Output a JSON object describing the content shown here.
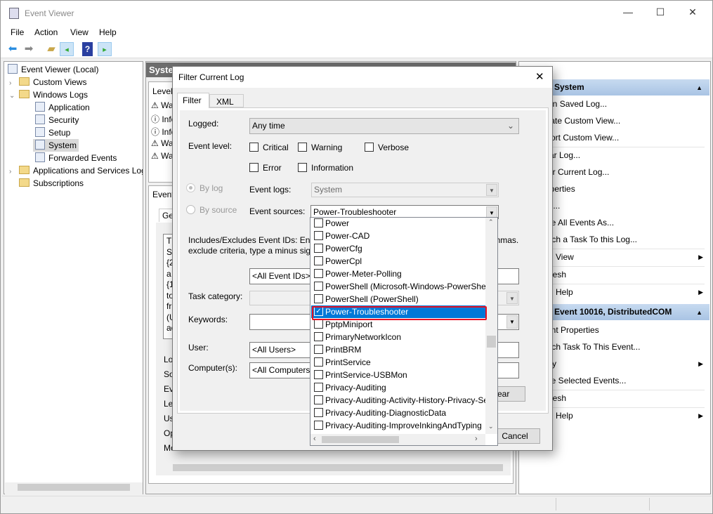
{
  "window": {
    "title": "Event Viewer",
    "controls": {
      "minimize": "—",
      "maximize": "☐",
      "close": "✕"
    }
  },
  "menu": [
    "File",
    "Action",
    "View",
    "Help"
  ],
  "toolbar": [
    "back-icon",
    "forward-icon",
    "open-folder-icon",
    "show-hide-tree-icon",
    "help-icon",
    "show-hide-action-pane-icon"
  ],
  "tree": {
    "root": "Event Viewer (Local)",
    "items": [
      {
        "label": "Custom Views",
        "level": 1,
        "expander": "›"
      },
      {
        "label": "Windows Logs",
        "level": 1,
        "expander": "⌄"
      },
      {
        "label": "Application",
        "level": 2
      },
      {
        "label": "Security",
        "level": 2
      },
      {
        "label": "Setup",
        "level": 2
      },
      {
        "label": "System",
        "level": 2,
        "selected": true
      },
      {
        "label": "Forwarded Events",
        "level": 2
      },
      {
        "label": "Applications and Services Logs",
        "level": 1,
        "expander": "›"
      },
      {
        "label": "Subscriptions",
        "level": 1
      }
    ]
  },
  "middle": {
    "header": "System",
    "list_header": "Level",
    "rows": [
      "Warning",
      "Information",
      "Information",
      "Warning",
      "Warning"
    ],
    "detail_header": "Event",
    "detail_tab": "General",
    "detail_text": [
      "Th",
      "Se",
      "{2",
      "a",
      "{1",
      "to",
      "fr",
      "(U",
      "ac"
    ],
    "detail_fields": [
      "Log",
      "Sou",
      "Eve",
      "Lev",
      "Use",
      "Op",
      "Mo"
    ]
  },
  "actions": {
    "section1": {
      "title": "System",
      "items": [
        {
          "label": "Open Saved Log..."
        },
        {
          "label": "Create Custom View..."
        },
        {
          "label": "Import Custom View..."
        },
        {
          "label": "Clear Log..."
        },
        {
          "label": "Filter Current Log..."
        },
        {
          "label": "Properties"
        },
        {
          "label": "Find..."
        },
        {
          "label": "Save All Events As..."
        },
        {
          "label": "Attach a Task To this Log..."
        },
        {
          "label": "View",
          "submenu": true
        },
        {
          "label": "Refresh"
        },
        {
          "label": "Help",
          "submenu": true
        }
      ]
    },
    "section2": {
      "title": "Event 10016, DistributedCOM",
      "items": [
        {
          "label": "Event Properties"
        },
        {
          "label": "Attach Task To This Event..."
        },
        {
          "label": "Copy",
          "submenu": true
        },
        {
          "label": "Save Selected Events..."
        },
        {
          "label": "Refresh"
        },
        {
          "label": "Help",
          "submenu": true
        }
      ]
    }
  },
  "dialog": {
    "title": "Filter Current Log",
    "tabs": [
      "Filter",
      "XML"
    ],
    "logged_label": "Logged:",
    "logged_value": "Any time",
    "event_level_label": "Event level:",
    "levels": [
      {
        "label": "Critical",
        "checked": false
      },
      {
        "label": "Warning",
        "checked": false
      },
      {
        "label": "Verbose",
        "checked": false
      },
      {
        "label": "Error",
        "checked": false
      },
      {
        "label": "Information",
        "checked": false
      }
    ],
    "by_log": "By log",
    "by_source": "By source",
    "event_logs_label": "Event logs:",
    "event_logs_value": "System",
    "event_sources_label": "Event sources:",
    "event_sources_value": "Power-Troubleshooter",
    "ids_text1": "Includes/Excludes Event IDs: Enter ID numbers and/or ID ranges separated by commas. To",
    "ids_text2": "exclude criteria, type a minus sign first. For example 1,3,5-99,-76",
    "ids_value": "<All Event IDs>",
    "task_label": "Task category:",
    "keywords_label": "Keywords:",
    "user_label": "User:",
    "user_value": "<All Users>",
    "computer_label": "Computer(s):",
    "computer_value": "<All Computers>",
    "clear_button": "Clear",
    "cancel_button": "Cancel",
    "close": "✕"
  },
  "sources_dropdown": [
    {
      "label": "Power",
      "checked": false
    },
    {
      "label": "Power-CAD",
      "checked": false
    },
    {
      "label": "PowerCfg",
      "checked": false
    },
    {
      "label": "PowerCpl",
      "checked": false
    },
    {
      "label": "Power-Meter-Polling",
      "checked": false
    },
    {
      "label": "PowerShell (Microsoft-Windows-PowerShell)",
      "checked": false
    },
    {
      "label": "PowerShell (PowerShell)",
      "checked": false
    },
    {
      "label": "Power-Troubleshooter",
      "checked": true,
      "selected": true
    },
    {
      "label": "PptpMiniport",
      "checked": false
    },
    {
      "label": "PrimaryNetworkIcon",
      "checked": false
    },
    {
      "label": "PrintBRM",
      "checked": false
    },
    {
      "label": "PrintService",
      "checked": false
    },
    {
      "label": "PrintService-USBMon",
      "checked": false
    },
    {
      "label": "Privacy-Auditing",
      "checked": false
    },
    {
      "label": "Privacy-Auditing-Activity-History-Privacy-Settings",
      "checked": false
    },
    {
      "label": "Privacy-Auditing-DiagnosticData",
      "checked": false
    },
    {
      "label": "Privacy-Auditing-ImproveInkingAndTyping",
      "checked": false
    }
  ],
  "colors": {
    "selection": "#0078d7",
    "highlight_box": "#e81123",
    "action_header": "#b7cfea"
  }
}
